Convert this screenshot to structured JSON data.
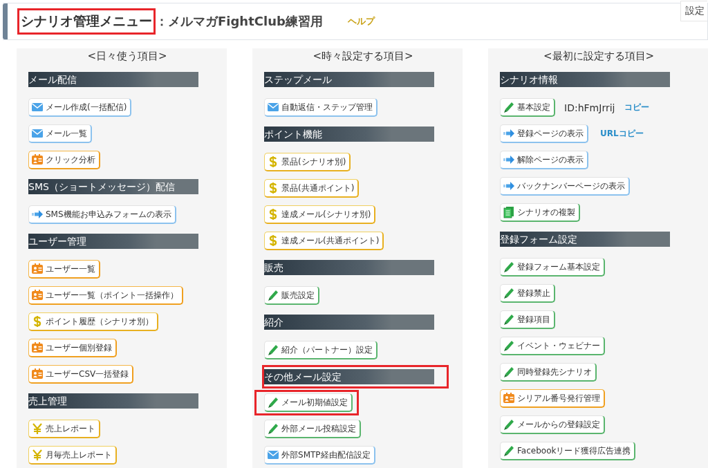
{
  "header": {
    "title": "シナリオ管理メニュー",
    "title_highlighted": true,
    "subtitle": "：メルマガFightClub練習用",
    "help_link": "ヘルプ",
    "corner_button": "設定"
  },
  "columns": [
    {
      "title": "<日々使う項目>",
      "sections": [
        {
          "heading": "メール配信",
          "highlighted": false,
          "items": [
            {
              "label": "メール作成(一括配信)",
              "kind": "mail",
              "highlighted": false
            },
            {
              "label": "メール一覧",
              "kind": "mail",
              "highlighted": false
            },
            {
              "label": "クリック分析",
              "kind": "card",
              "highlighted": false
            }
          ]
        },
        {
          "heading": "SMS（ショートメッセージ）配信",
          "highlighted": false,
          "items": [
            {
              "label": "SMS機能お申込みフォームの表示",
              "kind": "arrow",
              "highlighted": false
            }
          ]
        },
        {
          "heading": "ユーザー管理",
          "highlighted": false,
          "items": [
            {
              "label": "ユーザー一覧",
              "kind": "card",
              "highlighted": false
            },
            {
              "label": "ユーザー一覧（ポイント一括操作）",
              "kind": "card",
              "highlighted": false
            },
            {
              "label": "ポイント履歴（シナリオ別）",
              "kind": "dollar",
              "highlighted": false
            },
            {
              "label": "ユーザー個別登録",
              "kind": "card",
              "highlighted": false
            },
            {
              "label": "ユーザーCSV一括登録",
              "kind": "card",
              "highlighted": false
            }
          ]
        },
        {
          "heading": "売上管理",
          "highlighted": false,
          "items": [
            {
              "label": "売上レポート",
              "kind": "yen",
              "highlighted": false
            },
            {
              "label": "月毎売上レポート",
              "kind": "yen",
              "highlighted": false
            }
          ]
        }
      ]
    },
    {
      "title": "<時々設定する項目>",
      "sections": [
        {
          "heading": "ステップメール",
          "highlighted": false,
          "items": [
            {
              "label": "自動返信・ステップ管理",
              "kind": "mail",
              "highlighted": false
            }
          ]
        },
        {
          "heading": "ポイント機能",
          "highlighted": false,
          "items": [
            {
              "label": "景品(シナリオ別)",
              "kind": "dollar",
              "highlighted": false
            },
            {
              "label": "景品(共通ポイント)",
              "kind": "dollar",
              "highlighted": false
            },
            {
              "label": "達成メール(シナリオ別)",
              "kind": "dollar",
              "highlighted": false
            },
            {
              "label": "達成メール(共通ポイント)",
              "kind": "dollar",
              "highlighted": false
            }
          ]
        },
        {
          "heading": "販売",
          "highlighted": false,
          "items": [
            {
              "label": "販売設定",
              "kind": "pencil",
              "highlighted": false
            }
          ]
        },
        {
          "heading": "紹介",
          "highlighted": false,
          "items": [
            {
              "label": "紹介（パートナー）設定",
              "kind": "pencil",
              "highlighted": false
            }
          ]
        },
        {
          "heading": "その他メール設定",
          "highlighted": true,
          "items": [
            {
              "label": "メール初期値設定",
              "kind": "pencil",
              "highlighted": true
            },
            {
              "label": "外部メール投稿設定",
              "kind": "pencil",
              "highlighted": false
            },
            {
              "label": "外部SMTP経由配信設定",
              "kind": "mail",
              "highlighted": false
            }
          ]
        }
      ]
    },
    {
      "title": "<最初に設定する項目>",
      "sections": [
        {
          "heading": "シナリオ情報",
          "highlighted": false,
          "items": [
            {
              "label": "基本設定",
              "kind": "pencil",
              "highlighted": false,
              "extras": [
                {
                  "kind": "text",
                  "text": "ID:hFmJrrij"
                },
                {
                  "kind": "link",
                  "text": "コピー"
                }
              ]
            },
            {
              "label": "登録ページの表示",
              "kind": "arrow",
              "highlighted": false,
              "extras": [
                {
                  "kind": "link",
                  "text": "URLコピー"
                }
              ]
            },
            {
              "label": "解除ページの表示",
              "kind": "arrow",
              "highlighted": false
            },
            {
              "label": "バックナンバーページの表示",
              "kind": "arrow",
              "highlighted": false
            },
            {
              "label": "シナリオの複製",
              "kind": "copy",
              "highlighted": false
            }
          ]
        },
        {
          "heading": "登録フォーム設定",
          "highlighted": false,
          "items": [
            {
              "label": "登録フォーム基本設定",
              "kind": "pencil",
              "highlighted": false
            },
            {
              "label": "登録禁止",
              "kind": "pencil",
              "highlighted": false
            },
            {
              "label": "登録項目",
              "kind": "pencil",
              "highlighted": false
            },
            {
              "label": "イベント・ウェビナー",
              "kind": "pencil",
              "highlighted": false
            },
            {
              "label": "同時登録先シナリオ",
              "kind": "pencil",
              "highlighted": false
            },
            {
              "label": "シリアル番号発行管理",
              "kind": "card",
              "highlighted": false
            },
            {
              "label": "メールからの登録設定",
              "kind": "pencil",
              "highlighted": false
            },
            {
              "label": "Facebookリード獲得広告連携",
              "kind": "pencil",
              "highlighted": false
            }
          ]
        }
      ]
    }
  ]
}
